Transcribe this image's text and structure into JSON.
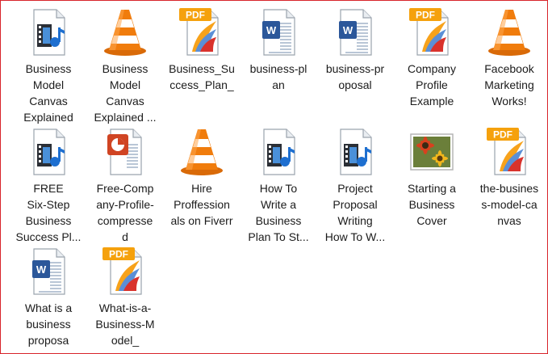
{
  "files": [
    {
      "name_lines": "Business\nModel\nCanvas\nExplained",
      "icon": "video-file-icon"
    },
    {
      "name_lines": "Business\nModel\nCanvas\nExplained ...",
      "icon": "vlc-cone-icon"
    },
    {
      "name_lines": "Business_Su\nccess_Plan_",
      "icon": "pdf-file-icon"
    },
    {
      "name_lines": "business-pl\nan",
      "icon": "word-document-icon"
    },
    {
      "name_lines": "business-pr\noposal",
      "icon": "word-document-icon"
    },
    {
      "name_lines": "Company\nProfile\nExample",
      "icon": "pdf-file-icon"
    },
    {
      "name_lines": "Facebook\nMarketing\nWorks!",
      "icon": "vlc-cone-icon"
    },
    {
      "name_lines": "FREE\nSix-Step\nBusiness\nSuccess Pl...",
      "icon": "video-file-icon"
    },
    {
      "name_lines": "Free-Comp\nany-Profile-\ncompresse\nd",
      "icon": "powerpoint-file-icon"
    },
    {
      "name_lines": "Hire\nProffession\nals on Fiverr",
      "icon": "vlc-cone-icon"
    },
    {
      "name_lines": "How To\nWrite a\nBusiness\nPlan To St...",
      "icon": "video-file-icon"
    },
    {
      "name_lines": "Project\nProposal\nWriting\nHow To W...",
      "icon": "video-file-icon"
    },
    {
      "name_lines": "Starting a\nBusiness\nCover",
      "icon": "image-file-icon"
    },
    {
      "name_lines": "the-busines\ns-model-ca\nnvas",
      "icon": "pdf-file-icon"
    },
    {
      "name_lines": "What is a\nbusiness\nproposa",
      "icon": "word-document-icon"
    },
    {
      "name_lines": "What-is-a-\nBusiness-M\nodel_",
      "icon": "pdf-file-icon"
    }
  ],
  "pdf_badge": "PDF",
  "colors": {
    "border": "#d8252b",
    "vlc_orange": "#f07c0c",
    "pdf_badge": "#f5a10d",
    "word_blue": "#2b579a",
    "ppt_orange": "#d04423"
  }
}
